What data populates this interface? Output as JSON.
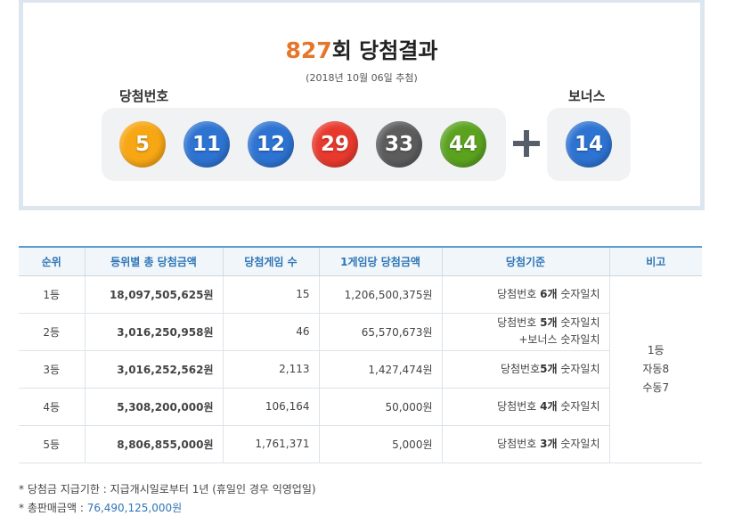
{
  "header": {
    "round": "827",
    "title_suffix": "회 당첨결과",
    "draw_date": "(2018년 10월 06일 추첨)",
    "win_label": "당첨번호",
    "bonus_label": "보너스"
  },
  "numbers": [
    {
      "value": "5",
      "color": "#f7a614"
    },
    {
      "value": "11",
      "color": "#2d73d2"
    },
    {
      "value": "12",
      "color": "#2d73d2"
    },
    {
      "value": "29",
      "color": "#e8392d"
    },
    {
      "value": "33",
      "color": "#5c5c5c"
    },
    {
      "value": "44",
      "color": "#5ba21f"
    }
  ],
  "bonus": {
    "value": "14",
    "color": "#2d73d2"
  },
  "table": {
    "headers": [
      "순위",
      "등위별 총 당첨금액",
      "당첨게임 수",
      "1게임당 당첨금액",
      "당첨기준",
      "비고"
    ],
    "rows": [
      {
        "rank": "1등",
        "total": "18,097,505,625원",
        "games": "15",
        "per_game": "1,206,500,375원",
        "crit_pre": "당첨번호 ",
        "crit_bold": "6개",
        "crit_post": " 숫자일치",
        "crit_line2": ""
      },
      {
        "rank": "2등",
        "total": "3,016,250,958원",
        "games": "46",
        "per_game": "65,570,673원",
        "crit_pre": "당첨번호 ",
        "crit_bold": "5개",
        "crit_post": " 숫자일치",
        "crit_line2": "+보너스 숫자일치"
      },
      {
        "rank": "3등",
        "total": "3,016,252,562원",
        "games": "2,113",
        "per_game": "1,427,474원",
        "crit_pre": "당첨번호",
        "crit_bold": "5개",
        "crit_post": " 숫자일치",
        "crit_line2": ""
      },
      {
        "rank": "4등",
        "total": "5,308,200,000원",
        "games": "106,164",
        "per_game": "50,000원",
        "crit_pre": "당첨번호 ",
        "crit_bold": "4개",
        "crit_post": " 숫자일치",
        "crit_line2": ""
      },
      {
        "rank": "5등",
        "total": "8,806,855,000원",
        "games": "1,761,371",
        "per_game": "5,000원",
        "crit_pre": "당첨번호 ",
        "crit_bold": "3개",
        "crit_post": " 숫자일치",
        "crit_line2": ""
      }
    ],
    "note_lines": [
      "1등",
      "자동8",
      "수동7"
    ]
  },
  "footnotes": {
    "deadline": "* 당첨금 지급기한 : 지급개시일로부터 1년 (휴일인 경우 익영업일)",
    "sales_label": "* 총판매금액 : ",
    "sales_value": "76,490,125,000원"
  }
}
